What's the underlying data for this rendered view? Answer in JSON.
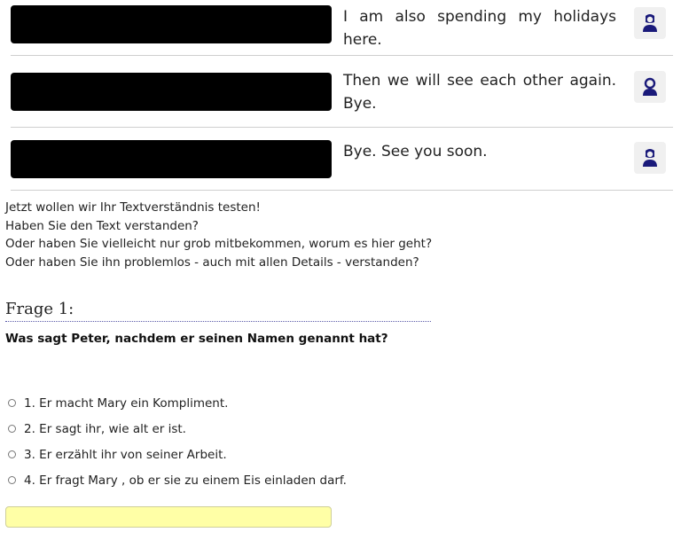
{
  "dialog": {
    "lines": [
      {
        "text": "I am also spending my holidays here.",
        "speaker_icon": "female-speaker-icon"
      },
      {
        "text": "Then we will see each other again. Bye.",
        "speaker_icon": "male-speaker-icon"
      },
      {
        "text": "Bye. See you soon.",
        "speaker_icon": "female-speaker-icon"
      }
    ]
  },
  "intro": [
    "Jetzt wollen wir Ihr Textverständnis testen!",
    "Haben Sie den Text verstanden?",
    "Oder haben Sie vielleicht nur grob mitbekommen, worum es hier geht?",
    "Oder haben Sie ihn problemlos - auch mit allen Details - verstanden?"
  ],
  "quiz": {
    "title": "Frage 1:",
    "question": "Was sagt Peter, nachdem er seinen Namen genannt hat?",
    "answers": [
      "1. Er macht Mary ein Kompliment.",
      "2. Er sagt ihr, wie alt er ist.",
      "3. Er erzählt ihr von seiner Arbeit.",
      "4. Er fragt Mary , ob er sie zu einem Eis einladen darf."
    ],
    "answer_value": ""
  },
  "colors": {
    "icon": "#1a1a7a",
    "input_bg": "#ffffa6",
    "separator": "#cfcfcf",
    "title_underline": "#5a5aa8"
  }
}
